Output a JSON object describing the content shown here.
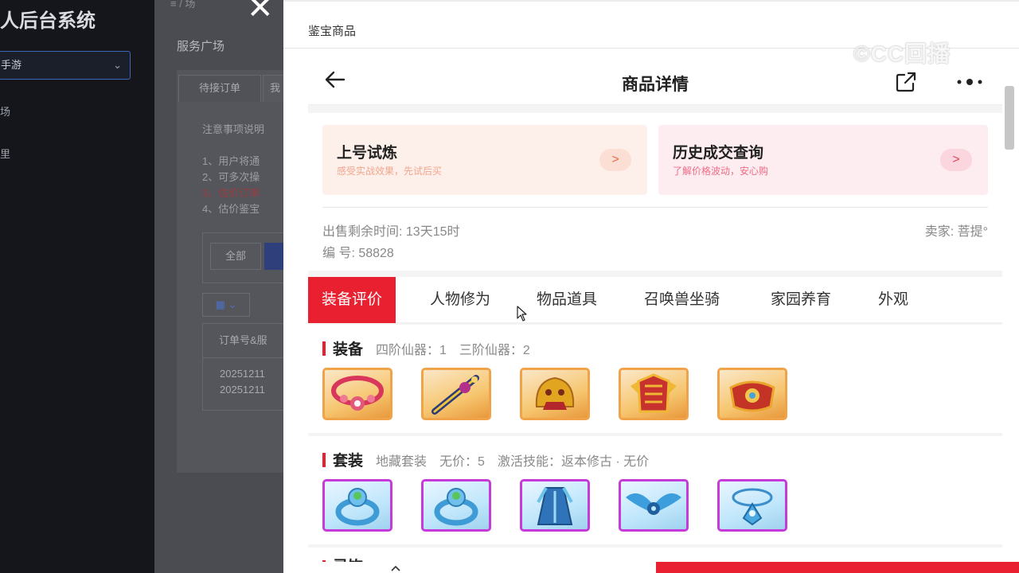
{
  "admin": {
    "title": "人后台系统",
    "game_select": "手游",
    "nav_items": [
      "场",
      "里"
    ],
    "breadcrumb": "≡   / 场 ",
    "page_heading": "服务广场",
    "tabs": [
      "待接订单",
      "我"
    ],
    "notes_title": "注意事项说明",
    "notes": [
      "1、用户将通",
      "2、可多次操",
      "3、估价订单",
      "4、估价鉴宝"
    ],
    "filter_all": "全部",
    "table_header": "订单号&服",
    "rows": [
      "20251211",
      "20251211"
    ]
  },
  "drawer": {
    "title": "鉴宝商品",
    "watermark": "©CC回播"
  },
  "detail": {
    "nav_title": "商品详情",
    "cards": [
      {
        "title": "上号试炼",
        "subtitle": "感受实战效果，先试后买",
        "arrow": ">"
      },
      {
        "title": "历史成交查询",
        "subtitle": "了解价格波动，安心购",
        "arrow": ">"
      }
    ],
    "remaining_time": "出售剩余时间: 13天15时",
    "seller": "卖家: 菩提°",
    "serial": "编 号: 58828",
    "tabs": [
      "装备评价",
      "人物修为",
      "物品道具",
      "召唤兽坐骑",
      "家园养育",
      "外观"
    ],
    "active_tab": "装备评价",
    "sections": [
      {
        "title": "装备",
        "meta": [
          "四阶仙器：1",
          "三阶仙器：2"
        ],
        "items": [
          "necklace",
          "sword",
          "helmet",
          "armor",
          "belt"
        ]
      },
      {
        "title": "套装",
        "meta": [
          "地藏套装",
          "无价：5",
          "激活技能：返本修古 · 无价"
        ],
        "items": [
          "ring",
          "ring",
          "robe",
          "wings",
          "pendant"
        ]
      }
    ],
    "next_section_peek": "灵饰"
  },
  "colors": {
    "accent_red": "#e8202f",
    "gold_frame": "#f1a34a",
    "purple_frame": "#c53ad9"
  }
}
